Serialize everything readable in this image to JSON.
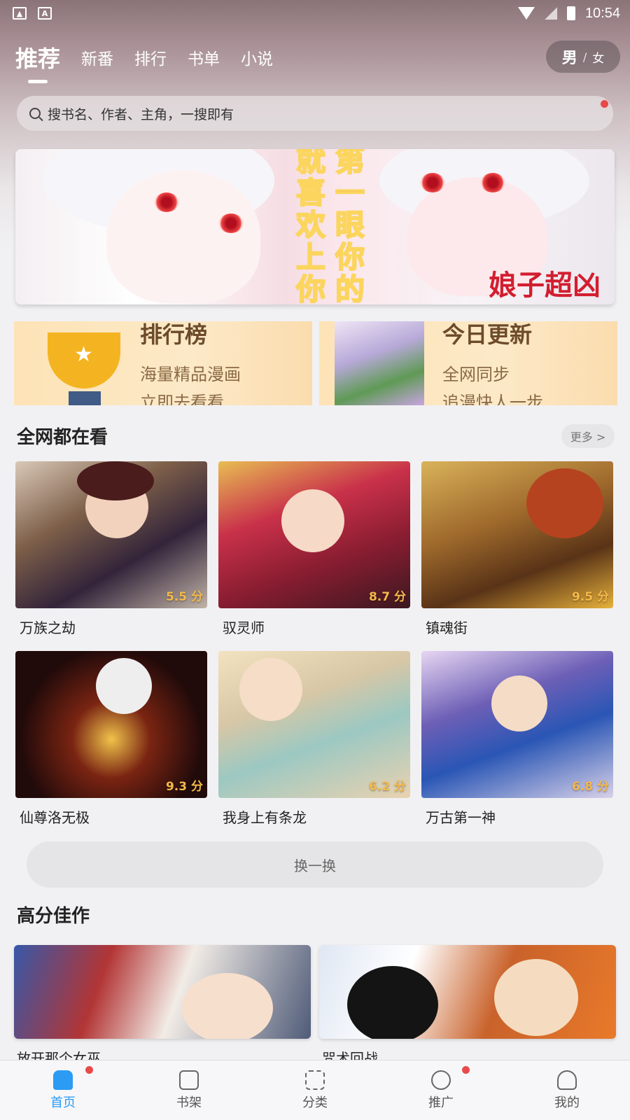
{
  "status_bar": {
    "time": "10:54",
    "left_icon_1": "image-icon",
    "left_icon_2": "A"
  },
  "top_tabs": [
    {
      "label": "推荐",
      "active": true
    },
    {
      "label": "新番",
      "active": false
    },
    {
      "label": "排行",
      "active": false
    },
    {
      "label": "书单",
      "active": false
    },
    {
      "label": "小说",
      "active": false
    }
  ],
  "gender_toggle": {
    "male": "男",
    "separator": "/",
    "female": "女"
  },
  "search": {
    "placeholder": "搜书名、作者、主角，一搜即有"
  },
  "banner": {
    "vertical_text_1": "就喜欢上你",
    "vertical_text_2": "第一眼你的",
    "title": "娘子超凶"
  },
  "promos": [
    {
      "title": "排行榜",
      "line1": "海量精品漫画",
      "line2": "立即去看看"
    },
    {
      "title": "今日更新",
      "line1": "全网同步",
      "line2": "追漫快人一步"
    }
  ],
  "section_hot": {
    "title": "全网都在看",
    "more_label": "更多 >",
    "items": [
      {
        "name": "万族之劫",
        "score": "5.5 分"
      },
      {
        "name": "驭灵师",
        "score": "8.7 分"
      },
      {
        "name": "镇魂街",
        "score": "9.5 分"
      },
      {
        "name": "仙尊洛无极",
        "score": "9.3 分"
      },
      {
        "name": "我身上有条龙",
        "score": "6.2 分"
      },
      {
        "name": "万古第一神",
        "score": "6.8 分"
      }
    ],
    "swap_label": "换一换"
  },
  "section_high": {
    "title": "高分佳作",
    "items": [
      {
        "name": "放开那个女巫"
      },
      {
        "name": "咒术回战"
      }
    ]
  },
  "bottom_nav": [
    {
      "label": "首页",
      "icon": "home-icon",
      "active": true,
      "dot": true
    },
    {
      "label": "书架",
      "icon": "bookshelf-icon",
      "active": false,
      "dot": false
    },
    {
      "label": "分类",
      "icon": "category-grid-icon",
      "active": false,
      "dot": false
    },
    {
      "label": "推广",
      "icon": "share-icon",
      "active": false,
      "dot": true
    },
    {
      "label": "我的",
      "icon": "user-icon",
      "active": false,
      "dot": false
    }
  ],
  "colors": {
    "accent": "#2b9bf4",
    "score": "#f5b94a",
    "dot": "#e84a4a"
  }
}
